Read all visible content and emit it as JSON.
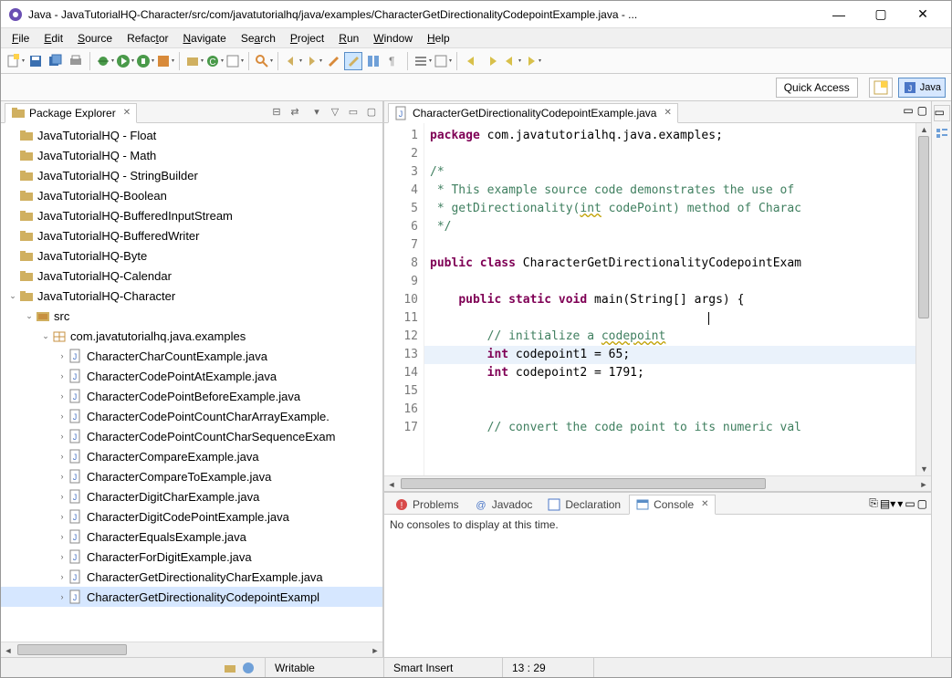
{
  "window": {
    "title": "Java - JavaTutorialHQ-Character/src/com/javatutorialhq/java/examples/CharacterGetDirectionalityCodepointExample.java - ..."
  },
  "menus": [
    "File",
    "Edit",
    "Source",
    "Refactor",
    "Navigate",
    "Search",
    "Project",
    "Run",
    "Window",
    "Help"
  ],
  "quickaccess": "Quick Access",
  "perspective": {
    "java": "Java"
  },
  "package_explorer": {
    "title": "Package Explorer",
    "projects": [
      "JavaTutorialHQ - Float",
      "JavaTutorialHQ - Math",
      "JavaTutorialHQ - StringBuilder",
      "JavaTutorialHQ-Boolean",
      "JavaTutorialHQ-BufferedInputStream",
      "JavaTutorialHQ-BufferedWriter",
      "JavaTutorialHQ-Byte",
      "JavaTutorialHQ-Calendar"
    ],
    "open_project": "JavaTutorialHQ-Character",
    "src": "src",
    "pkg": "com.javatutorialhq.java.examples",
    "files": [
      "CharacterCharCountExample.java",
      "CharacterCodePointAtExample.java",
      "CharacterCodePointBeforeExample.java",
      "CharacterCodePointCountCharArrayExample.",
      "CharacterCodePointCountCharSequenceExam",
      "CharacterCompareExample.java",
      "CharacterCompareToExample.java",
      "CharacterDigitCharExample.java",
      "CharacterDigitCodePointExample.java",
      "CharacterEqualsExample.java",
      "CharacterForDigitExample.java",
      "CharacterGetDirectionalityCharExample.java",
      "CharacterGetDirectionalityCodepointExampl"
    ]
  },
  "editor": {
    "tab": "CharacterGetDirectionalityCodepointExample.java",
    "lines": [
      {
        "n": 1,
        "html": "<span class='kw'>package</span> com.javatutorialhq.java.examples;"
      },
      {
        "n": 2,
        "html": ""
      },
      {
        "n": 3,
        "html": "<span class='cm'>/*</span>"
      },
      {
        "n": 4,
        "html": "<span class='cm'> * This example source code demonstrates the use of</span>"
      },
      {
        "n": 5,
        "html": "<span class='cm'> * getDirectionality(<span class='uline'>int</span> codePoint) method of Charac</span>"
      },
      {
        "n": 6,
        "html": "<span class='cm'> */</span>"
      },
      {
        "n": 7,
        "html": ""
      },
      {
        "n": 8,
        "html": "<span class='kw'>public</span> <span class='kw'>class</span> CharacterGetDirectionalityCodepointExam"
      },
      {
        "n": 9,
        "html": ""
      },
      {
        "n": 10,
        "html": "    <span class='kw'>public</span> <span class='kw'>static</span> <span class='kw'>void</span> main(String[] args) {"
      },
      {
        "n": 11,
        "html": "                                       <span class='text-cursor'></span>"
      },
      {
        "n": 12,
        "html": "        <span class='cm'>// initialize a <span class='uline'>codepoint</span></span>"
      },
      {
        "n": 13,
        "html": "        <span class='kw'>int</span> codepoint1 = 65;"
      },
      {
        "n": 14,
        "html": "        <span class='kw'>int</span> codepoint2 = 1791;"
      },
      {
        "n": 15,
        "html": ""
      },
      {
        "n": 16,
        "html": ""
      },
      {
        "n": 17,
        "html": "        <span class='cm'>// convert the code point to its numeric val</span>"
      }
    ]
  },
  "bottom_tabs": {
    "problems": "Problems",
    "javadoc": "Javadoc",
    "declaration": "Declaration",
    "console": "Console"
  },
  "console_msg": "No consoles to display at this time.",
  "status": {
    "writable": "Writable",
    "insert": "Smart Insert",
    "pos": "13 : 29"
  }
}
